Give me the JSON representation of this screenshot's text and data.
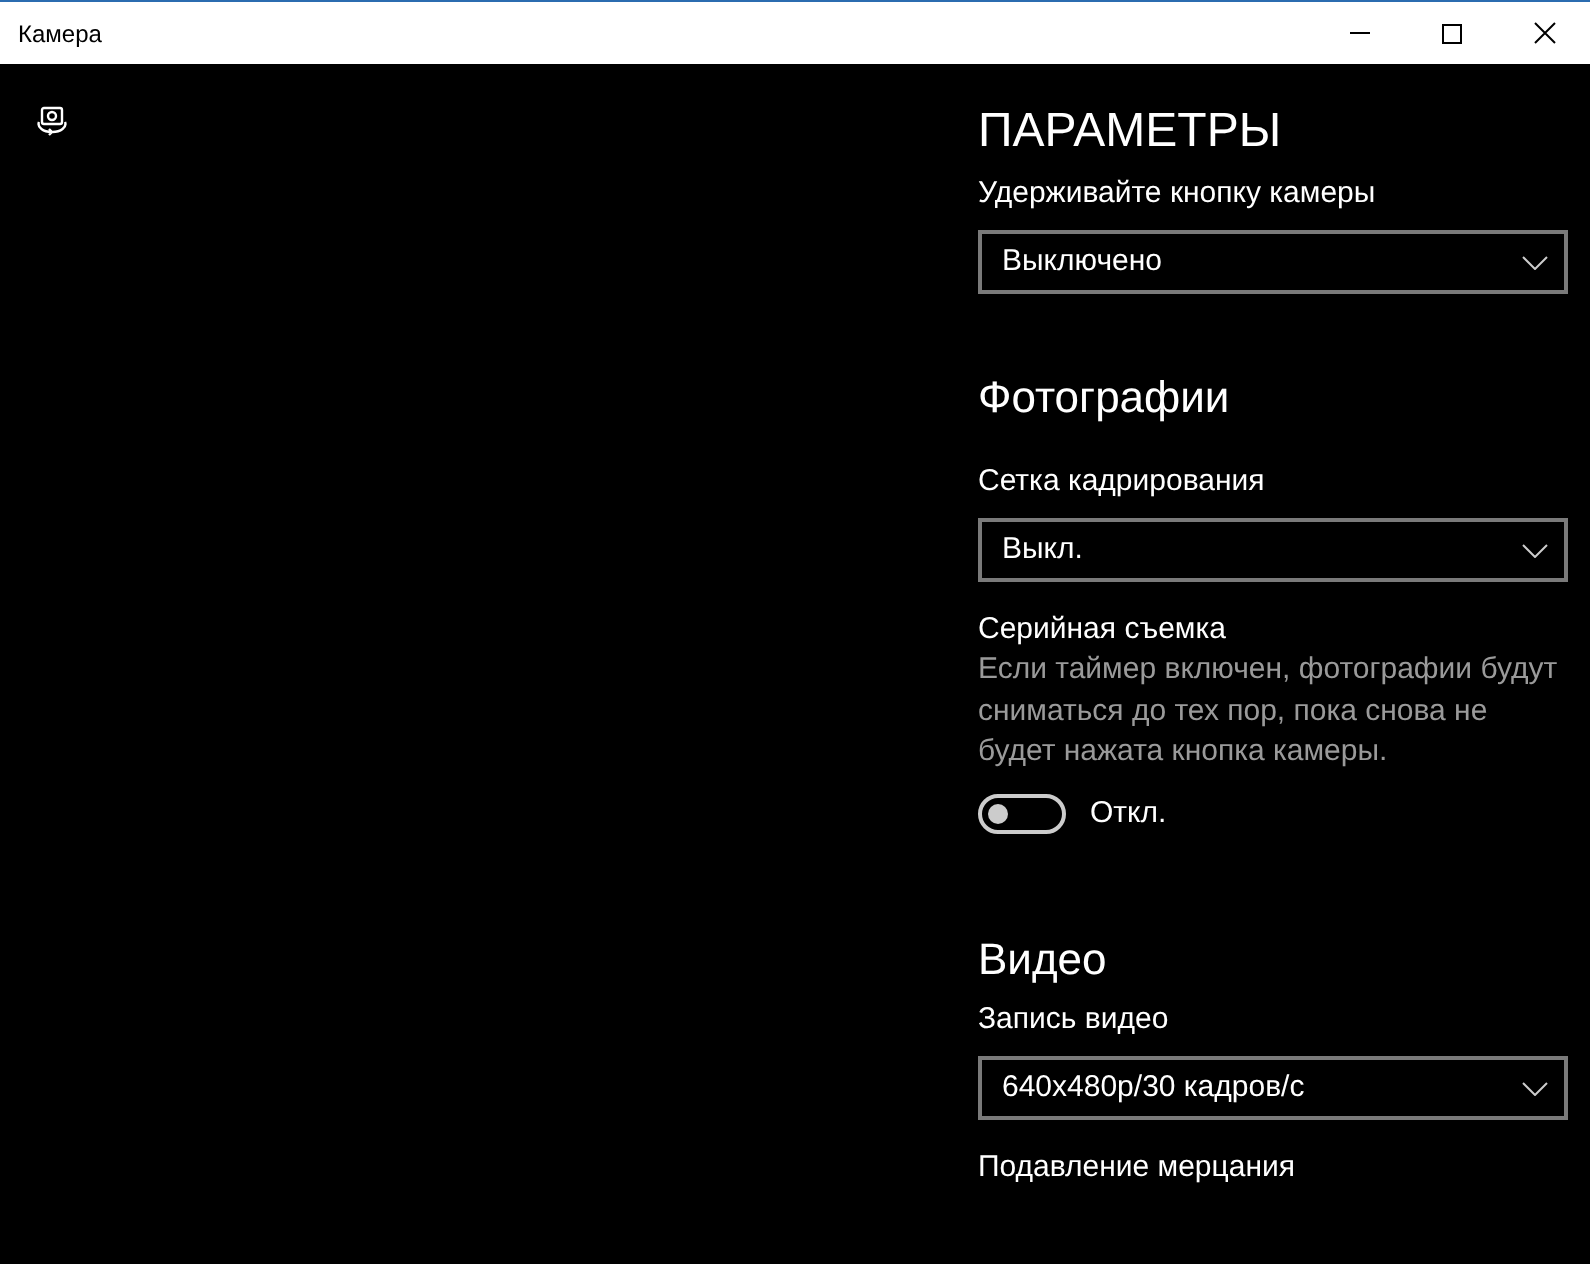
{
  "window": {
    "title": "Камера"
  },
  "panel": {
    "title": "ПАРАМЕТРЫ",
    "settings": [
      {
        "kind": "dropdown",
        "label": "Удерживайте кнопку камеры",
        "value": "Выключено"
      }
    ],
    "sections": [
      {
        "title": "Фотографии",
        "settings": [
          {
            "kind": "dropdown",
            "label": "Сетка кадрирования",
            "value": "Выкл."
          },
          {
            "kind": "toggle",
            "label": "Серийная съемка",
            "description": "Если таймер включен, фотографии будут сниматься до тех пор, пока снова не будет нажата кнопка камеры.",
            "on": false,
            "state_label": "Откл."
          }
        ]
      },
      {
        "title": "Видео",
        "settings": [
          {
            "kind": "dropdown",
            "label": "Запись видео",
            "value": "640x480p/30 кадров/с"
          },
          {
            "kind": "label",
            "label": "Подавление мерцания"
          }
        ]
      }
    ]
  }
}
